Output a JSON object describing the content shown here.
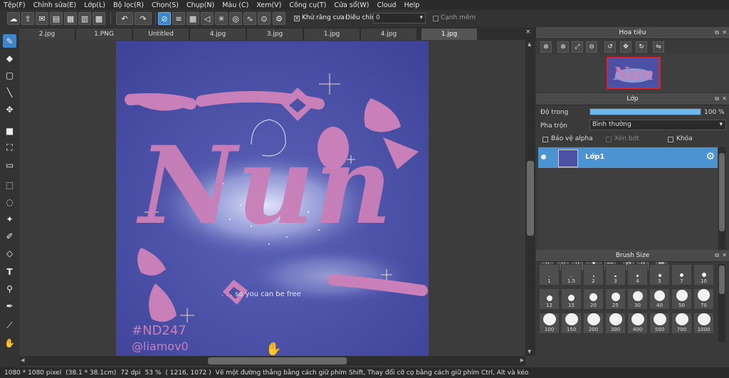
{
  "menu": [
    "Tệp(F)",
    "Chỉnh sửa(E)",
    "Lớp(L)",
    "Bộ lọc(R)",
    "Chọn(S)",
    "Chụp(N)",
    "Màu (C)",
    "Xem(V)",
    "Công cụ(T)",
    "Cửa sổ(W)",
    "Cloud",
    "Help"
  ],
  "toolbar": {
    "antialias_label": "Khử răng cưa",
    "adjust_label": "Điều chỉnh",
    "adjust_value": "0",
    "soft_edge_label": "Cạnh mềm"
  },
  "tabs": [
    "2.jpg",
    "1.PNG",
    "Untitled",
    "4.jpg",
    "3.jpg",
    "1.jpg",
    "4.jpg",
    "1.jpg"
  ],
  "artwork": {
    "lettering": "Nun",
    "caption": ". . . so you can be free",
    "signature_1": "#ND247",
    "signature_2": "@liamov0"
  },
  "navigator": {
    "title": "Hoa tiêu"
  },
  "layers": {
    "title": "Lớp",
    "opacity_label": "Độ trong",
    "opacity_value": "100 %",
    "opacity_fraction": 1.0,
    "blend_label": "Pha trộn",
    "blend_value": "Bình thường",
    "protect_alpha_label": "Bảo vệ alpha",
    "clipping_label": "Xén bớt",
    "lock_label": "Khóa",
    "layer_name": "Lớp1"
  },
  "brush_size": {
    "title": "Brush Size",
    "sizes": [
      "1",
      "1.5",
      "2",
      "3",
      "4",
      "5",
      "7",
      "10",
      "12",
      "15",
      "20",
      "25",
      "30",
      "40",
      "50",
      "70",
      "100",
      "150",
      "200",
      "300",
      "400",
      "500",
      "700",
      "1000"
    ]
  },
  "status": {
    "dimensions": "1080 * 1080 pixel",
    "physical": "(38.1 * 38.1cm)",
    "dpi": "72 dpi",
    "zoom": "53 %",
    "coords": "( 1216, 1072 )",
    "hint": "Vẽ một đường thẳng bằng cách giữ phím Shift, Thay đổi cỡ cọ bằng cách giữ phím Ctrl, Alt và kéo"
  },
  "colors": {
    "accent": "#3e86c8",
    "artwork_bg": "#4b52a6",
    "lettering": "#c97fb8"
  }
}
